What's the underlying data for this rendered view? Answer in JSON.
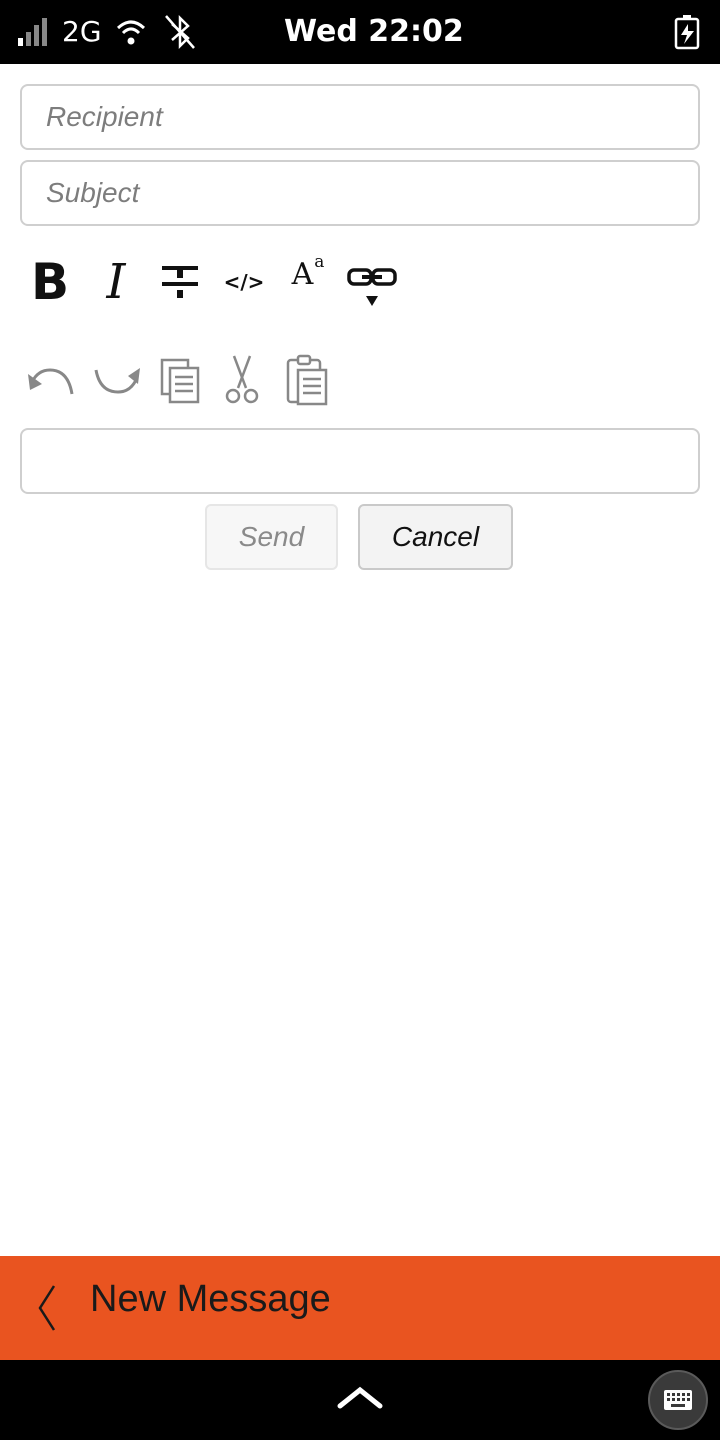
{
  "status_bar": {
    "network": "2G",
    "time": "Wed 22:02",
    "icons": [
      "signal-icon",
      "wifi-icon",
      "bluetooth-off-icon",
      "battery-charging-icon"
    ]
  },
  "form": {
    "recipient_placeholder": "Recipient",
    "subject_placeholder": "Subject",
    "body_value": ""
  },
  "toolbar": {
    "bold_label": "B",
    "italic_label": "I",
    "code_label": "</>",
    "font_label": "A",
    "font_sup": "a",
    "icons": [
      "bold-icon",
      "italic-icon",
      "strikethrough-icon",
      "code-icon",
      "font-size-icon",
      "link-icon",
      "undo-icon",
      "redo-icon",
      "copy-icon",
      "cut-icon",
      "paste-icon"
    ]
  },
  "actions": {
    "send_label": "Send",
    "cancel_label": "Cancel"
  },
  "header": {
    "title": "New Message",
    "accent_color": "#e95420"
  }
}
